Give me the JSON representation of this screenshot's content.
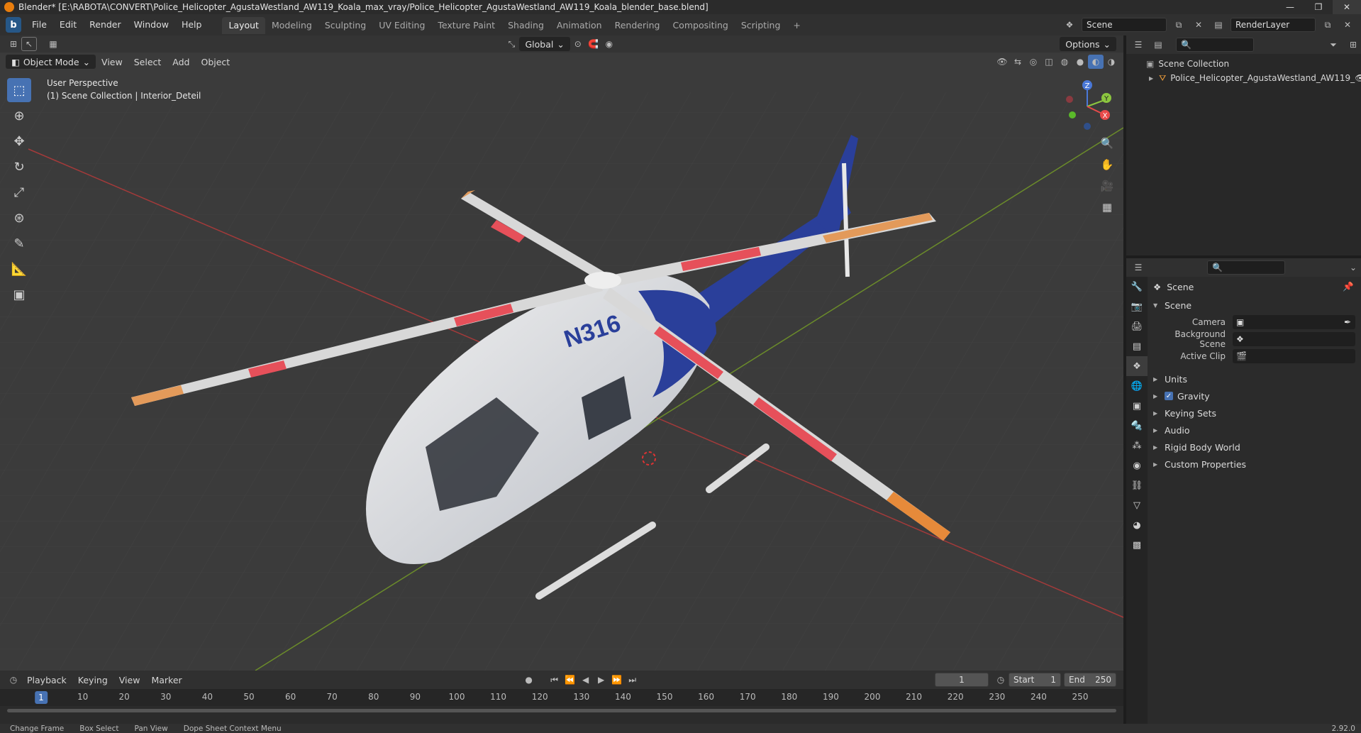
{
  "window": {
    "title": "Blender* [E:\\RABOTA\\CONVERT\\Police_Helicopter_AgustaWestland_AW119_Koala_max_vray/Police_Helicopter_AgustaWestland_AW119_Koala_blender_base.blend]",
    "controls": {
      "minimize": "—",
      "maximize": "❐",
      "close": "✕"
    }
  },
  "menu": {
    "logo": "b",
    "items": [
      "File",
      "Edit",
      "Render",
      "Window",
      "Help"
    ],
    "workspaces": [
      "Layout",
      "Modeling",
      "Sculpting",
      "UV Editing",
      "Texture Paint",
      "Shading",
      "Animation",
      "Rendering",
      "Compositing",
      "Scripting"
    ],
    "active_workspace": "Layout",
    "add_workspace": "+",
    "scene_field": "Scene",
    "view_layer_field": "RenderLayer"
  },
  "viewport": {
    "mode": "Object Mode",
    "menus": [
      "View",
      "Select",
      "Add",
      "Object"
    ],
    "transform_orientation": "Global",
    "options_label": "Options",
    "info_line1": "User Perspective",
    "info_line2": "(1) Scene Collection | Interior_Deteil",
    "gizmo": {
      "x": "X",
      "y": "Y",
      "z": "Z"
    },
    "tools": [
      "select-box-tool-icon",
      "cursor-tool-icon",
      "move-tool-icon",
      "rotate-tool-icon",
      "scale-tool-icon",
      "transform-tool-icon",
      "annotate-tool-icon",
      "measure-tool-icon",
      "add-cube-tool-icon"
    ],
    "model_label": "N316"
  },
  "outliner": {
    "root": "Scene Collection",
    "items": [
      {
        "name": "Police_Helicopter_AgustaWestland_AW119_"
      }
    ]
  },
  "properties": {
    "context": "Scene",
    "panel_title": "Scene",
    "fields": [
      {
        "label": "Camera",
        "value": ""
      },
      {
        "label": "Background Scene",
        "value": ""
      },
      {
        "label": "Active Clip",
        "value": ""
      }
    ],
    "sections": [
      {
        "label": "Units",
        "checkbox": false
      },
      {
        "label": "Gravity",
        "checkbox": true
      },
      {
        "label": "Keying Sets",
        "checkbox": false
      },
      {
        "label": "Audio",
        "checkbox": false
      },
      {
        "label": "Rigid Body World",
        "checkbox": false
      },
      {
        "label": "Custom Properties",
        "checkbox": false
      }
    ]
  },
  "timeline": {
    "menus": [
      "Playback",
      "Keying",
      "View",
      "Marker"
    ],
    "current_frame": "1",
    "start_label": "Start",
    "start": "1",
    "end_label": "End",
    "end": "250",
    "ruler": [
      "1",
      "10",
      "20",
      "30",
      "40",
      "50",
      "60",
      "70",
      "80",
      "90",
      "100",
      "110",
      "120",
      "130",
      "140",
      "150",
      "160",
      "170",
      "180",
      "190",
      "200",
      "210",
      "220",
      "230",
      "240",
      "250"
    ]
  },
  "statusbar": {
    "items": [
      "Change Frame",
      "Box Select",
      "Pan View",
      "Dope Sheet Context Menu"
    ],
    "version": "2.92.0"
  }
}
